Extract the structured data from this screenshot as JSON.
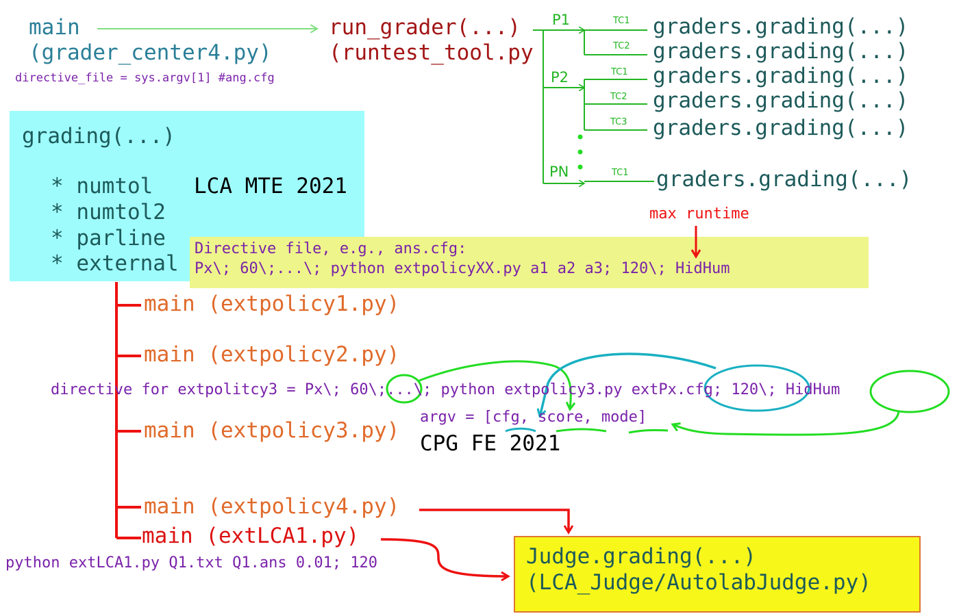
{
  "colors": {
    "teal": "#2a7f98",
    "darkred": "#a31515",
    "darkteal": "#1d5a5a",
    "green": "#22b522",
    "brightgreen": "#22dd22",
    "purple": "#7a22aa",
    "orange": "#e06a2a",
    "red": "#ee1111",
    "cyan": "#9ffcfc",
    "lightyellow": "#eef58a",
    "yellow": "#f7f71a",
    "boxorange": "#e07530",
    "cyanarrow": "#19b0c2"
  },
  "top": {
    "main_label": "main",
    "main_file": "(grader_center4.py)",
    "directive_code": "directive_file = sys.argv[1] #ang.cfg",
    "run_grader_label": "run_grader(...)",
    "run_grader_file": "(runtest_tool.py"
  },
  "tree": {
    "problems": [
      "P1",
      "P2",
      "PN"
    ],
    "testcases": [
      "TC1",
      "TC2",
      "TC1",
      "TC2",
      "TC3",
      "TC1"
    ],
    "grading_calls": [
      "graders.grading(...)",
      "graders.grading(...)",
      "graders.grading(...)",
      "graders.grading(...)",
      "graders.grading(...)",
      "graders.grading(...)"
    ]
  },
  "grading_box": {
    "title": "grading(...)",
    "items": [
      "* numtol",
      "* numtol2",
      "* parline",
      "* external"
    ],
    "tag": "LCA MTE 2021"
  },
  "directive_box": {
    "annotation": "max runtime",
    "line1": "Directive file, e.g., ans.cfg:",
    "line2": "Px\\; 60\\;...\\; python extpolicyXX.py a1 a2 a3; 120\\; HidHum"
  },
  "ext_mains": [
    "main (extpolicy1.py)",
    "main (extpolicy2.py)",
    "main (extpolicy3.py)",
    "main (extpolicy4.py)",
    "main (extLCA1.py)"
  ],
  "extpolicy3": {
    "directive": "directive for extpolitcy3 = Px\\; 60\\;...\\; python extpolicy3.py extPx.cfg; 120\\; HidHum",
    "argv": "argv = [cfg, score, mode]",
    "tag": "CPG FE 2021"
  },
  "extlca": {
    "command": "python extLCA1.py Q1.txt Q1.ans 0.01; 120"
  },
  "judge_box": {
    "line1": "Judge.grading(...)",
    "line2": "(LCA_Judge/AutolabJudge.py)"
  }
}
